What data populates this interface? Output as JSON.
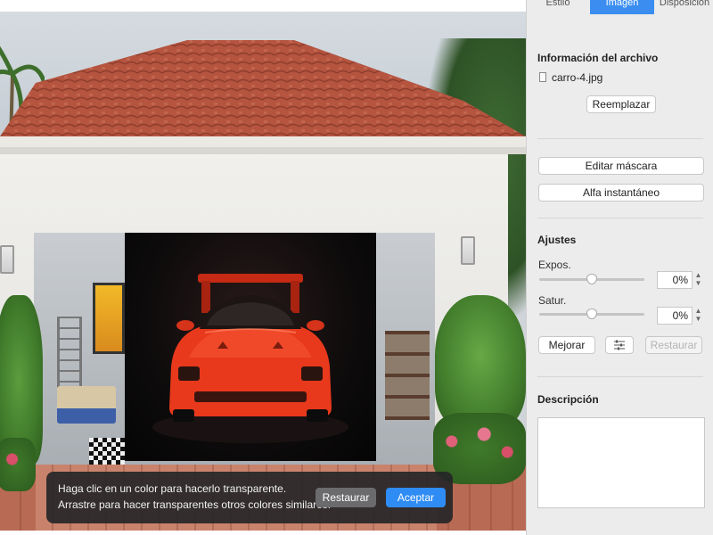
{
  "inspector": {
    "tabs": [
      {
        "label": "Estilo",
        "active": false
      },
      {
        "label": "Imagen",
        "active": true
      },
      {
        "label": "Disposición",
        "active": false
      }
    ],
    "file_info": {
      "title": "Información del archivo",
      "filename": "carro-4.jpg",
      "replace_label": "Reemplazar"
    },
    "mask": {
      "edit_mask_label": "Editar máscara",
      "instant_alpha_label": "Alfa instantáneo"
    },
    "adjustments": {
      "title": "Ajustes",
      "exposure": {
        "label": "Expos.",
        "value": "0%",
        "level": 0.5
      },
      "saturation": {
        "label": "Satur.",
        "value": "0%",
        "level": 0.5
      },
      "enhance_label": "Mejorar",
      "restore_label": "Restaurar"
    },
    "description": {
      "title": "Descripción",
      "value": ""
    }
  },
  "instant_alpha_bar": {
    "line1": "Haga clic en un color para hacerlo transparente.",
    "line2": "Arrastre para hacer transparentes otros colores similares.",
    "restore_label": "Restaurar",
    "accept_label": "Aceptar"
  },
  "colors": {
    "accent": "#2f8cf4",
    "tab_active": "#3b8ef0",
    "car_red": "#e8391c"
  },
  "icons": {
    "file": "file-icon",
    "adjust": "sliders-icon",
    "stepper": "stepper-icon"
  }
}
